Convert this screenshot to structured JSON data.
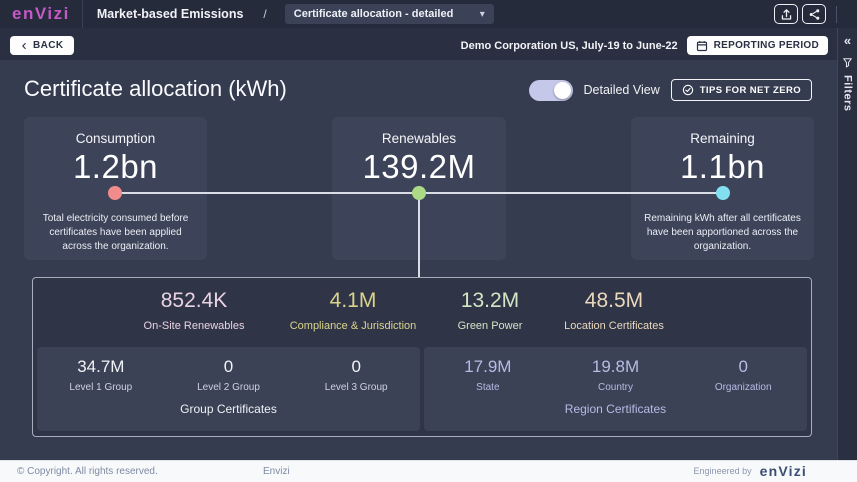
{
  "brand": {
    "logo": "enVizi",
    "footer_logo": "enVizi"
  },
  "topbar": {
    "breadcrumb": "Market-based Emissions",
    "separator": "/",
    "report_selector": "Certificate allocation - detailed",
    "caret": "▾",
    "export_icon": "export-icon",
    "share_icon": "share-icon"
  },
  "subbar": {
    "back_label": "BACK",
    "context": "Demo Corporation US, July-19 to June-22",
    "reporting_period_label": "REPORTING PERIOD"
  },
  "sidebar": {
    "collapse_glyph": "«",
    "filters_label": "Filters"
  },
  "page": {
    "title": "Certificate allocation (kWh)",
    "toggle_label": "Detailed View",
    "toggle_state": "on",
    "toggle_color": "#c6c8ea",
    "tips_button": "TIPS FOR NET ZERO"
  },
  "cards": [
    {
      "title": "Consumption",
      "value": "1.2bn",
      "dot_color": "#f08c8c",
      "description": "Total electricity consumed before certificates have been applied across the organization."
    },
    {
      "title": "Renewables",
      "value": "139.2M",
      "dot_color": "#abd985",
      "description": ""
    },
    {
      "title": "Remaining",
      "value": "1.1bn",
      "dot_color": "#82dff0",
      "description": "Remaining kWh after all certificates have been apportioned across the organization."
    }
  ],
  "breakdown": {
    "stats": [
      {
        "value": "852.4K",
        "label": "On-Site Renewables",
        "color": "#e9d3e3"
      },
      {
        "value": "4.1M",
        "label": "Compliance & Jurisdiction",
        "color": "#dbd48b"
      },
      {
        "value": "13.2M",
        "label": "Green Power",
        "color": "#d3e5c5"
      },
      {
        "value": "48.5M",
        "label": "Location Certificates",
        "color": "#ead8bd"
      }
    ],
    "group_certificates": {
      "caption": "Group Certificates",
      "stats": [
        {
          "value": "34.7M",
          "label": "Level 1 Group"
        },
        {
          "value": "0",
          "label": "Level 2 Group"
        },
        {
          "value": "0",
          "label": "Level 3 Group"
        }
      ]
    },
    "region_certificates": {
      "caption": "Region Certificates",
      "stats": [
        {
          "value": "17.9M",
          "label": "State"
        },
        {
          "value": "19.8M",
          "label": "Country"
        },
        {
          "value": "0",
          "label": "Organization"
        }
      ]
    }
  },
  "footer": {
    "copyright": "© Copyright. All rights reserved.",
    "center": "Envizi",
    "engineered_by": "Engineered by"
  }
}
